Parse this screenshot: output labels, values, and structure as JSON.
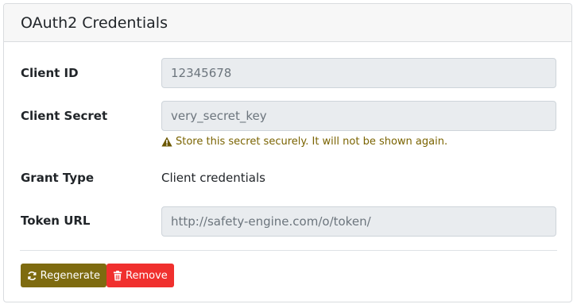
{
  "card": {
    "title": "OAuth2 Credentials"
  },
  "fields": {
    "client_id": {
      "label": "Client ID",
      "value": "12345678"
    },
    "client_secret": {
      "label": "Client Secret",
      "value": "very_secret_key",
      "warning": "Store this secret securely. It will not be shown again."
    },
    "grant_type": {
      "label": "Grant Type",
      "value": "Client credentials"
    },
    "token_url": {
      "label": "Token URL",
      "value": "http://safety-engine.com/o/token/"
    }
  },
  "actions": {
    "regenerate_label": "Regenerate",
    "remove_label": "Remove"
  },
  "icons": {
    "warning": "warning-triangle-icon",
    "regenerate": "refresh-icon",
    "remove": "trash-icon"
  },
  "colors": {
    "regenerate_bg": "#7e6b10",
    "remove_bg": "#f0302e",
    "warning_text": "#7a6300"
  }
}
